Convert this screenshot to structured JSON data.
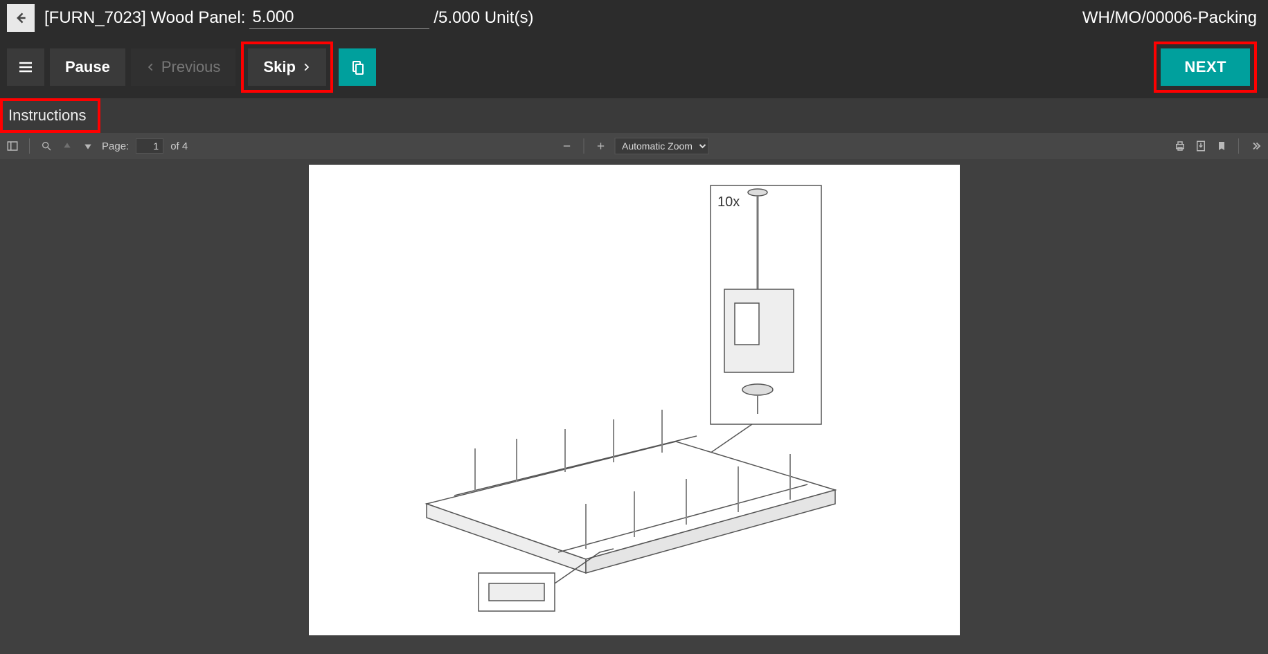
{
  "header": {
    "product_prefix": "[FURN_7023] Wood Panel:",
    "qty_done": "5.000",
    "qty_suffix": "/5.000 Unit(s)",
    "order_ref": "WH/MO/00006-Packing"
  },
  "actions": {
    "pause": "Pause",
    "previous": "Previous",
    "skip": "Skip",
    "next": "NEXT"
  },
  "tabs": {
    "instructions": "Instructions"
  },
  "pdf": {
    "page_label": "Page:",
    "current_page": "1",
    "total_pages_label": "of 4",
    "zoom_mode": "Automatic Zoom",
    "callout_label": "10x"
  }
}
